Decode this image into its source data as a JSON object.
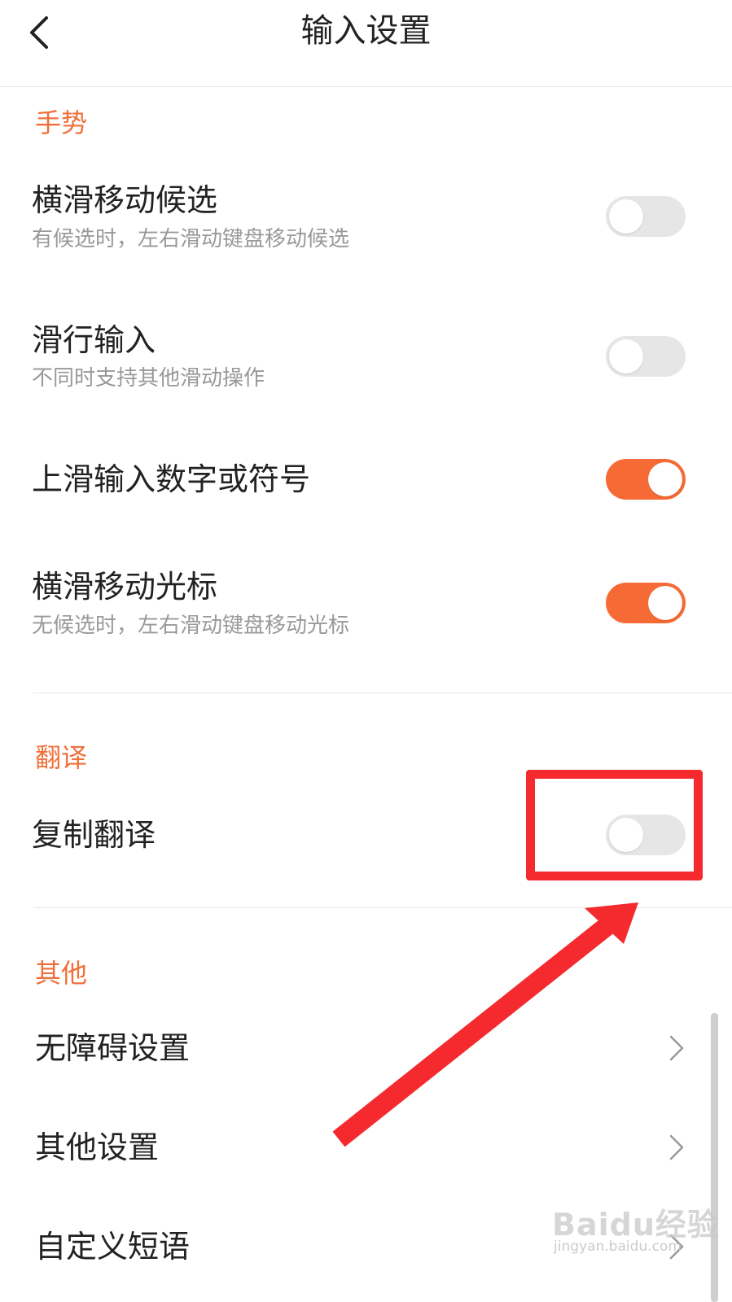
{
  "header": {
    "title": "输入设置",
    "back_icon": "chevron-left-icon"
  },
  "sections": {
    "gesture": {
      "title": "手势",
      "items": [
        {
          "title": "横滑移动候选",
          "subtitle": "有候选时，左右滑动键盘移动候选",
          "enabled": false
        },
        {
          "title": "滑行输入",
          "subtitle": "不同时支持其他滑动操作",
          "enabled": false
        },
        {
          "title": "上滑输入数字或符号",
          "enabled": true
        },
        {
          "title": "横滑移动光标",
          "subtitle": "无候选时，左右滑动键盘移动光标",
          "enabled": true
        }
      ]
    },
    "translate": {
      "title": "翻译",
      "items": [
        {
          "title": "复制翻译",
          "enabled": false
        }
      ]
    },
    "other": {
      "title": "其他",
      "items": [
        {
          "title": "无障碍设置",
          "icon": "chevron-right-icon"
        },
        {
          "title": "其他设置",
          "icon": "chevron-right-icon"
        },
        {
          "title": "自定义短语",
          "icon": "chevron-right-icon"
        }
      ]
    }
  },
  "colors": {
    "accent": "#f06f3a",
    "toggle_on": "#f66b35",
    "toggle_off": "#e6e6e6",
    "annotation": "#f42a2e"
  },
  "watermark": {
    "logo": "Baidu经验",
    "url": "jingyan.baidu.com"
  }
}
